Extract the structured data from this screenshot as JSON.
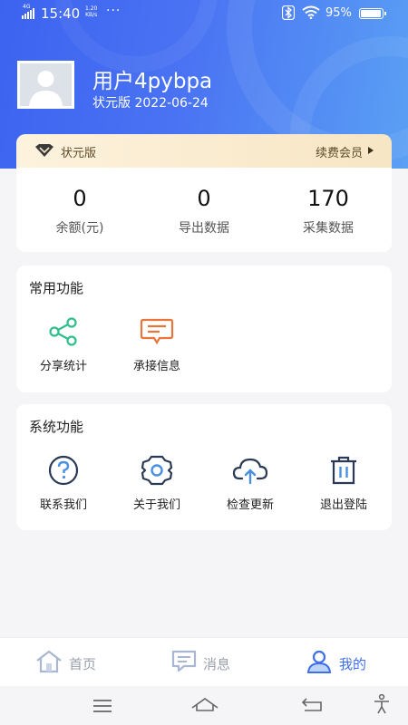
{
  "status_bar": {
    "network": "4G",
    "time": "15:40",
    "speed_value": "1.20",
    "speed_unit": "KB/s",
    "more": "···",
    "battery": "95%",
    "battery_level": 0.95
  },
  "profile": {
    "username": "用户4pybpa",
    "subtitle": "状元版 2022-06-24"
  },
  "vip": {
    "label": "状元版",
    "renew_label": "续费会员"
  },
  "stats": [
    {
      "value": "0",
      "label": "余额(元)"
    },
    {
      "value": "0",
      "label": "导出数据"
    },
    {
      "value": "170",
      "label": "采集数据"
    }
  ],
  "common": {
    "title": "常用功能",
    "items": [
      {
        "label": "分享统计",
        "icon": "share-icon",
        "color": "#2fbf8a"
      },
      {
        "label": "承接信息",
        "icon": "message-icon",
        "color": "#e8763a"
      }
    ]
  },
  "system": {
    "title": "系统功能",
    "items": [
      {
        "label": "联系我们",
        "icon": "help-icon"
      },
      {
        "label": "关于我们",
        "icon": "gear-icon"
      },
      {
        "label": "检查更新",
        "icon": "cloud-upload-icon"
      },
      {
        "label": "退出登陆",
        "icon": "trash-icon"
      }
    ]
  },
  "tabs": [
    {
      "label": "首页",
      "icon": "home-icon",
      "active": false
    },
    {
      "label": "消息",
      "icon": "message-icon",
      "active": false
    },
    {
      "label": "我的",
      "icon": "user-icon",
      "active": true
    }
  ],
  "colors": {
    "accent": "#3f6fea",
    "vip_gold": "#f7e6c4",
    "inactive": "#9aa0ac",
    "icon_dark": "#2a3a55"
  }
}
